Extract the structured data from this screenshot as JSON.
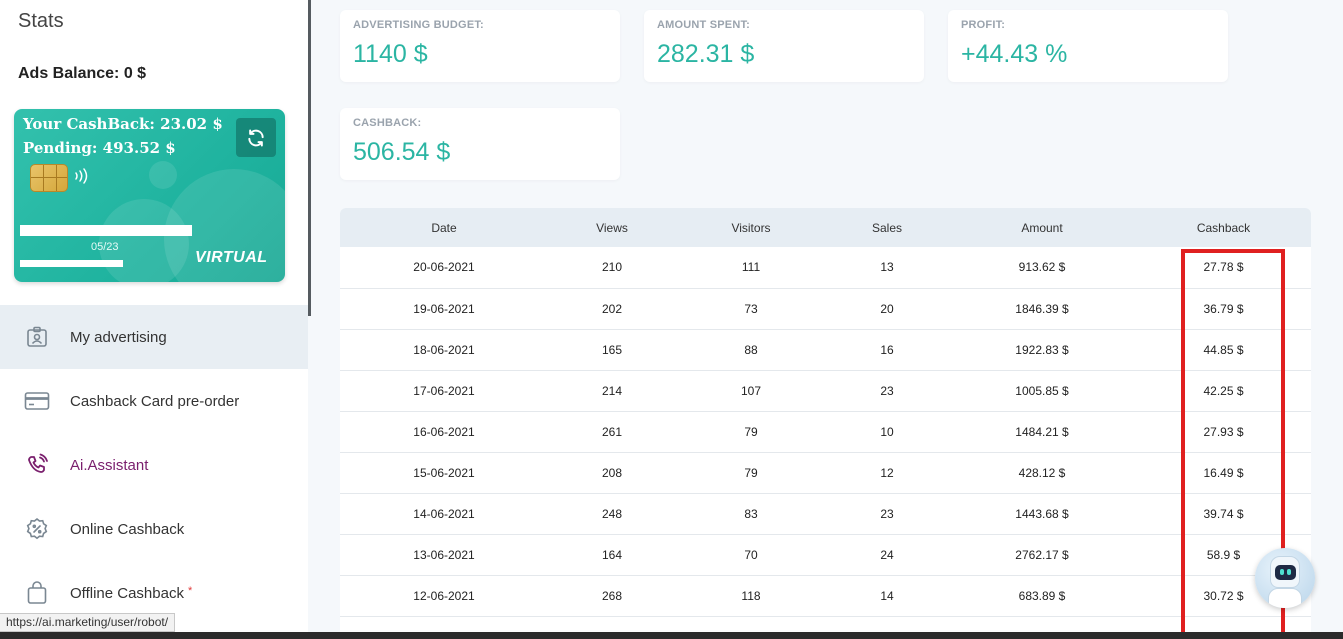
{
  "sidebar": {
    "title": "Stats",
    "ads_balance": "Ads Balance: 0 $",
    "card": {
      "cashback": "Your CashBack: 23.02 $",
      "pending": "Pending: 493.52 $",
      "expiry": "05/23",
      "type": "VIRTUAL",
      "refresh_icon": "refresh-icon",
      "accent_color": "#2bb5a3"
    },
    "menu": [
      {
        "label": "My advertising",
        "icon": "id-badge-icon",
        "active": true
      },
      {
        "label": "Cashback Card pre-order",
        "icon": "credit-card-icon",
        "active": false
      },
      {
        "label": "Ai.Assistant",
        "icon": "phone-ring-icon",
        "active": false
      },
      {
        "label": "Online Cashback",
        "icon": "percent-badge-icon",
        "active": false
      },
      {
        "label": "Offline Cashback",
        "icon": "shopping-bag-icon",
        "active": false,
        "star": "*"
      }
    ]
  },
  "stats": {
    "advertising_budget": {
      "label": "ADVERTISING BUDGET:",
      "value": "1140 $"
    },
    "amount_spent": {
      "label": "AMOUNT SPENT:",
      "value": "282.31 $"
    },
    "profit": {
      "label": "PROFIT:",
      "value": "+44.43 %"
    },
    "cashback": {
      "label": "CASHBACK:",
      "value": "506.54 $"
    }
  },
  "table": {
    "headers": [
      "Date",
      "Views",
      "Visitors",
      "Sales",
      "Amount",
      "Cashback"
    ],
    "rows": [
      [
        "20-06-2021",
        "210",
        "111",
        "13",
        "913.62 $",
        "27.78 $"
      ],
      [
        "19-06-2021",
        "202",
        "73",
        "20",
        "1846.39 $",
        "36.79 $"
      ],
      [
        "18-06-2021",
        "165",
        "88",
        "16",
        "1922.83 $",
        "44.85 $"
      ],
      [
        "17-06-2021",
        "214",
        "107",
        "23",
        "1005.85 $",
        "42.25 $"
      ],
      [
        "16-06-2021",
        "261",
        "79",
        "10",
        "1484.21 $",
        "27.93 $"
      ],
      [
        "15-06-2021",
        "208",
        "79",
        "12",
        "428.12 $",
        "16.49 $"
      ],
      [
        "14-06-2021",
        "248",
        "83",
        "23",
        "1443.68 $",
        "39.74 $"
      ],
      [
        "13-06-2021",
        "164",
        "70",
        "24",
        "2762.17 $",
        "58.9 $"
      ],
      [
        "12-06-2021",
        "268",
        "118",
        "14",
        "683.89 $",
        "30.72 $"
      ]
    ]
  },
  "status_bar": {
    "url": "https://ai.marketing/user/robot/"
  },
  "colors": {
    "highlight": "#e02020",
    "stat_value": "#2bb5a3"
  }
}
